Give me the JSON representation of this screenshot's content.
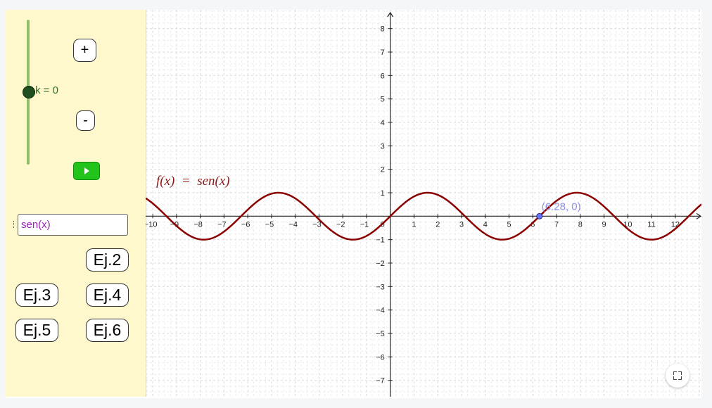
{
  "slider": {
    "label": "k = 0",
    "value": 0
  },
  "buttons": {
    "plus": "+",
    "minus": "-"
  },
  "input": {
    "value": "sen(x)"
  },
  "examples": {
    "ej2": "Ej.2",
    "ej3": "Ej.3",
    "ej4": "Ej.4",
    "ej5": "Ej.5",
    "ej6": "Ej.6"
  },
  "graph": {
    "function_label": "f(x)  =  sen(x)",
    "point_label": "(6.28, 0)",
    "point": [
      6.28,
      0
    ],
    "x_range": [
      -10.3,
      13.1
    ],
    "y_range": [
      -7.7,
      8.8
    ],
    "x_ticks": [
      -10,
      -9,
      -8,
      -7,
      -6,
      -5,
      -4,
      -3,
      -2,
      -1,
      0,
      1,
      2,
      3,
      4,
      5,
      6,
      7,
      8,
      9,
      10,
      11,
      12
    ],
    "y_ticks": [
      -7,
      -6,
      -5,
      -4,
      -3,
      -2,
      -1,
      1,
      2,
      3,
      4,
      5,
      6,
      7,
      8
    ],
    "colors": {
      "curve": "#8b0000",
      "point": "#6675ff",
      "point_label": "#8f8fe8",
      "function_label": "#8b1a1a"
    }
  }
}
